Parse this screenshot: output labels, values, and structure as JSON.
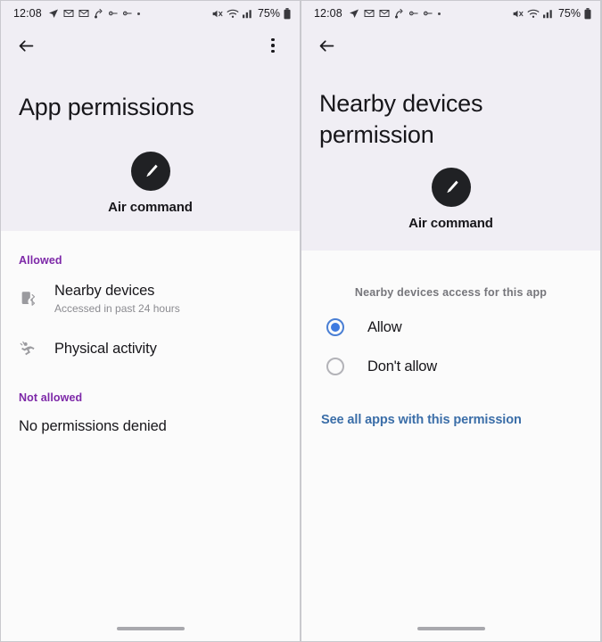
{
  "statusbar": {
    "time": "12:08",
    "battery": "75%",
    "left_icons": [
      "navigation-arrow-icon",
      "mail-icon",
      "mail-icon",
      "sound-bounce-icon",
      "link-icon",
      "link-icon",
      "dot-icon"
    ],
    "right_icons": [
      "mute-icon",
      "wifi-icon",
      "signal-icon",
      "battery-icon"
    ]
  },
  "colors": {
    "header_bg": "#f0eef4",
    "body_bg": "#fbfbfb",
    "accent_purple": "#7d28a8",
    "link_blue": "#3b6ea8",
    "radio_blue": "#3e7ae0",
    "app_icon_bg": "#202124"
  },
  "left_panel": {
    "appbar": {
      "back_icon": "back-arrow-icon",
      "overflow_icon": "kebab-menu-icon"
    },
    "title": "App permissions",
    "app": {
      "icon": "air-command-spen-icon",
      "name": "Air command"
    },
    "allowed_label": "Allowed",
    "allowed_items": [
      {
        "icon": "nearby-devices-bluetooth-icon",
        "title": "Nearby devices",
        "subtitle": "Accessed in past 24 hours"
      },
      {
        "icon": "physical-activity-running-icon",
        "title": "Physical activity",
        "subtitle": ""
      }
    ],
    "not_allowed_label": "Not allowed",
    "not_allowed_text": "No permissions denied"
  },
  "right_panel": {
    "appbar": {
      "back_icon": "back-arrow-icon"
    },
    "title": "Nearby devices permission",
    "app": {
      "icon": "air-command-spen-icon",
      "name": "Air command"
    },
    "options_header": "Nearby devices access for this app",
    "options": [
      {
        "label": "Allow",
        "selected": true
      },
      {
        "label": "Don't allow",
        "selected": false
      }
    ],
    "link": "See all apps with this permission"
  }
}
